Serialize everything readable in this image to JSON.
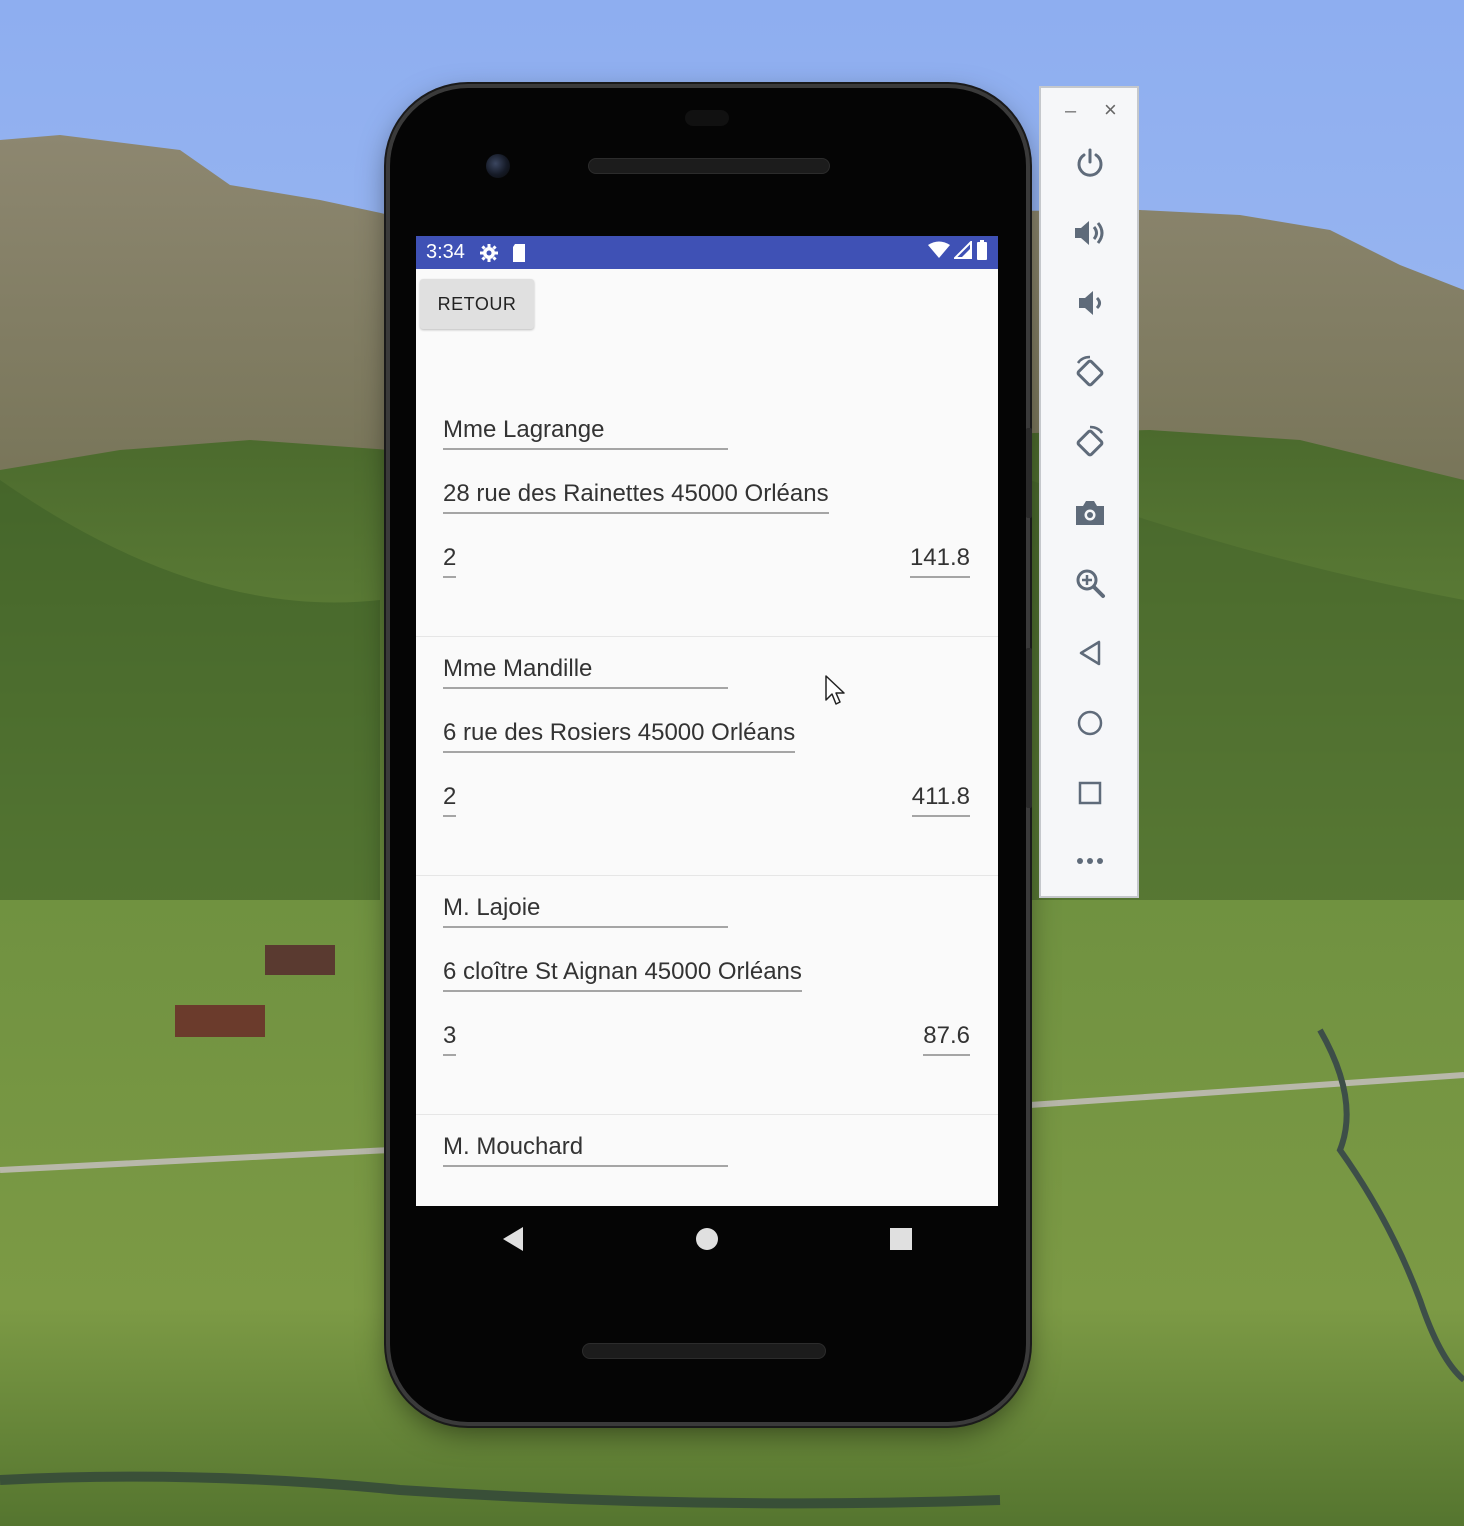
{
  "colors": {
    "status_bar": "#3f51b5",
    "screen_background": "#fafafa",
    "button_background": "#e0e0e0",
    "toolbar_icon": "#5f6b7a"
  },
  "status_bar": {
    "time": "3:34",
    "left_icons": [
      "settings-icon",
      "sd-card-icon"
    ],
    "right_icons": [
      "wifi-icon",
      "signal-icon",
      "battery-icon"
    ]
  },
  "app": {
    "back_button_label": "RETOUR",
    "clients": [
      {
        "name": "Mme Lagrange",
        "address": "28 rue des Rainettes 45000 Orléans",
        "quantity": "2",
        "amount": "141.8"
      },
      {
        "name": "Mme Mandille",
        "address": "6 rue des Rosiers 45000 Orléans",
        "quantity": "2",
        "amount": "411.8"
      },
      {
        "name": "M. Lajoie",
        "address": "6 cloître St Aignan 45000 Orléans",
        "quantity": "3",
        "amount": "87.6"
      },
      {
        "name": "M. Mouchard"
      }
    ]
  },
  "navigation_bar": {
    "buttons": [
      "back-icon",
      "home-icon",
      "recents-icon"
    ]
  },
  "emulator_toolbar": {
    "window_controls": {
      "minimize": "–",
      "close": "×"
    },
    "items": [
      "power-icon",
      "volume-up-icon",
      "volume-down-icon",
      "rotate-left-icon",
      "rotate-right-icon",
      "screenshot-icon",
      "zoom-icon",
      "back-icon",
      "home-icon",
      "overview-icon",
      "more-icon"
    ]
  }
}
